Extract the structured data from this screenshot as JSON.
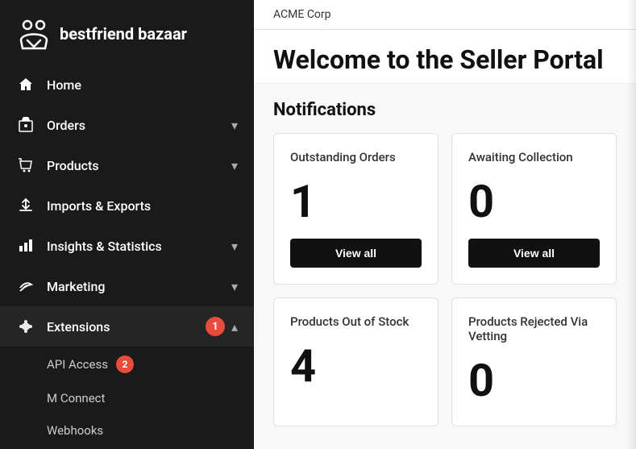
{
  "logo": {
    "name": "bestfriend bazaar"
  },
  "company": "ACME Corp",
  "page_title": "Welcome to the Seller Portal",
  "notifications_heading": "Notifications",
  "nav": {
    "home": "Home",
    "orders": "Orders",
    "products": "Products",
    "imports_exports": "Imports & Exports",
    "insights": "Insights & Statistics",
    "marketing": "Marketing",
    "extensions": "Extensions",
    "extensions_badge": "1",
    "api_access": "API Access",
    "api_access_badge": "2",
    "m_connect": "M Connect",
    "webhooks": "Webhooks",
    "chevron_down": "▾",
    "chevron_up": "▴"
  },
  "cards": [
    {
      "label": "Outstanding Orders",
      "count": "1",
      "btn_label": "View all"
    },
    {
      "label": "Awaiting Collection",
      "count": "0",
      "btn_label": "View all"
    },
    {
      "label": "Products Out of Stock",
      "count": "4",
      "btn_label": null
    },
    {
      "label": "Products Rejected Via Vetting",
      "count": "0",
      "btn_label": null
    }
  ]
}
